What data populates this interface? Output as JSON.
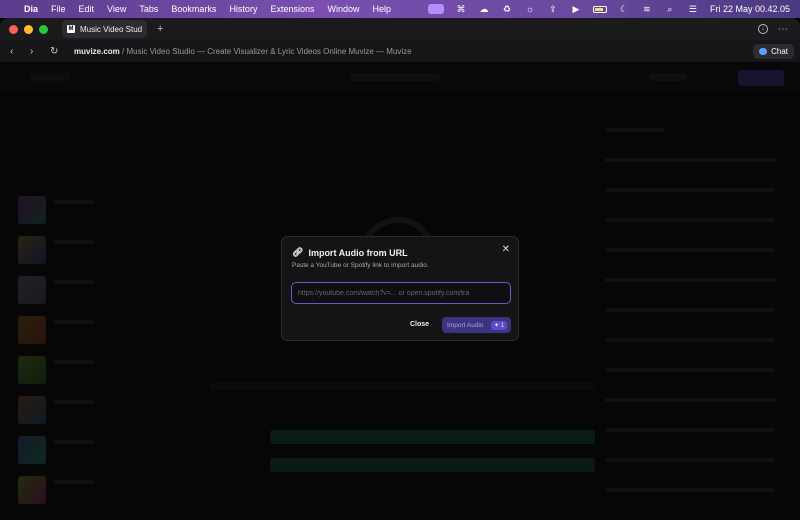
{
  "menubar": {
    "app_name": "Dia",
    "menus": [
      "File",
      "Edit",
      "View",
      "Tabs",
      "Bookmarks",
      "History",
      "Extensions",
      "Window",
      "Help"
    ],
    "clock": "Fri 22 May  00.42.05"
  },
  "tab": {
    "title": "Music Video Stud"
  },
  "addressbar": {
    "domain": "muvize.com",
    "path": " / Music Video Studio — Create Visualizer & Lyric Videos Online Muvize — Muvize",
    "chat_label": "Chat"
  },
  "modal": {
    "title": "Import Audio from URL",
    "subtitle": "Paste a YouTube or Spotify link to import audio.",
    "input_placeholder": "https://youtube.com/watch?v=... or open.spotify.com/tra",
    "close_label": "Close",
    "import_label": "Import Audio",
    "credit_badge": "✦ 1",
    "close_x": "✕"
  },
  "colors": {
    "accent": "#6a5acd",
    "import_button": "#3b3480",
    "modal_bg": "#141416"
  }
}
